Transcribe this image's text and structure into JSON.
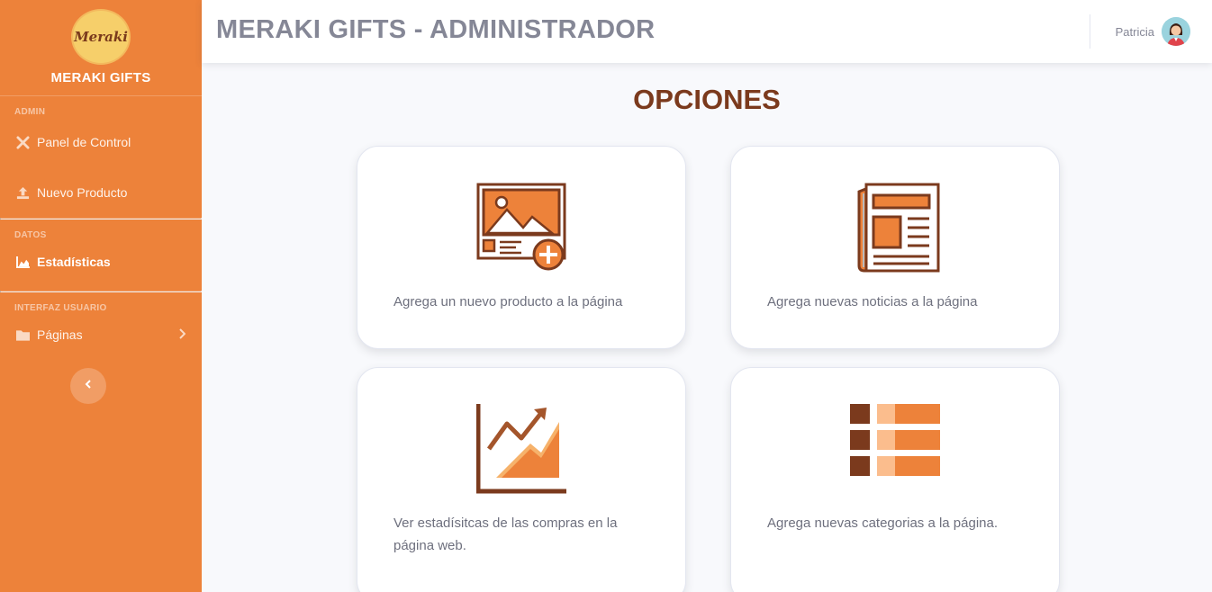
{
  "brand": {
    "logo_text": "Meraki",
    "name": "MERAKI GIFTS"
  },
  "sidebar": {
    "sections": [
      {
        "heading": "ADMIN"
      },
      {
        "heading": "DATOS"
      },
      {
        "heading": "INTERFAZ USUARIO"
      }
    ],
    "items": [
      {
        "label": "Panel de Control",
        "icon": "tools-icon"
      },
      {
        "label": "Nuevo Producto",
        "icon": "upload-icon"
      },
      {
        "label": "Estadísticas",
        "icon": "area-chart-icon",
        "active": true
      },
      {
        "label": "Páginas",
        "icon": "folder-icon"
      }
    ]
  },
  "topbar": {
    "title": "MERAKI GIFTS - ADMINISTRADOR",
    "user_name": "Patricia"
  },
  "main": {
    "heading": "OPCIONES",
    "cards": [
      {
        "text": "Agrega un nuevo producto a la página",
        "icon": "add-image-icon"
      },
      {
        "text": "Agrega nuevas noticias a la página",
        "icon": "newspaper-icon"
      },
      {
        "text": "Ver estadísitcas de las compras en la página web.",
        "icon": "growth-chart-icon"
      },
      {
        "text": "Agrega nuevas categorias a la página.",
        "icon": "list-categories-icon"
      }
    ]
  },
  "colors": {
    "sidebar": "#ed823a",
    "accent_dark": "#7b3a1d",
    "accent_light": "#f6b26b",
    "text_muted": "#858796"
  }
}
